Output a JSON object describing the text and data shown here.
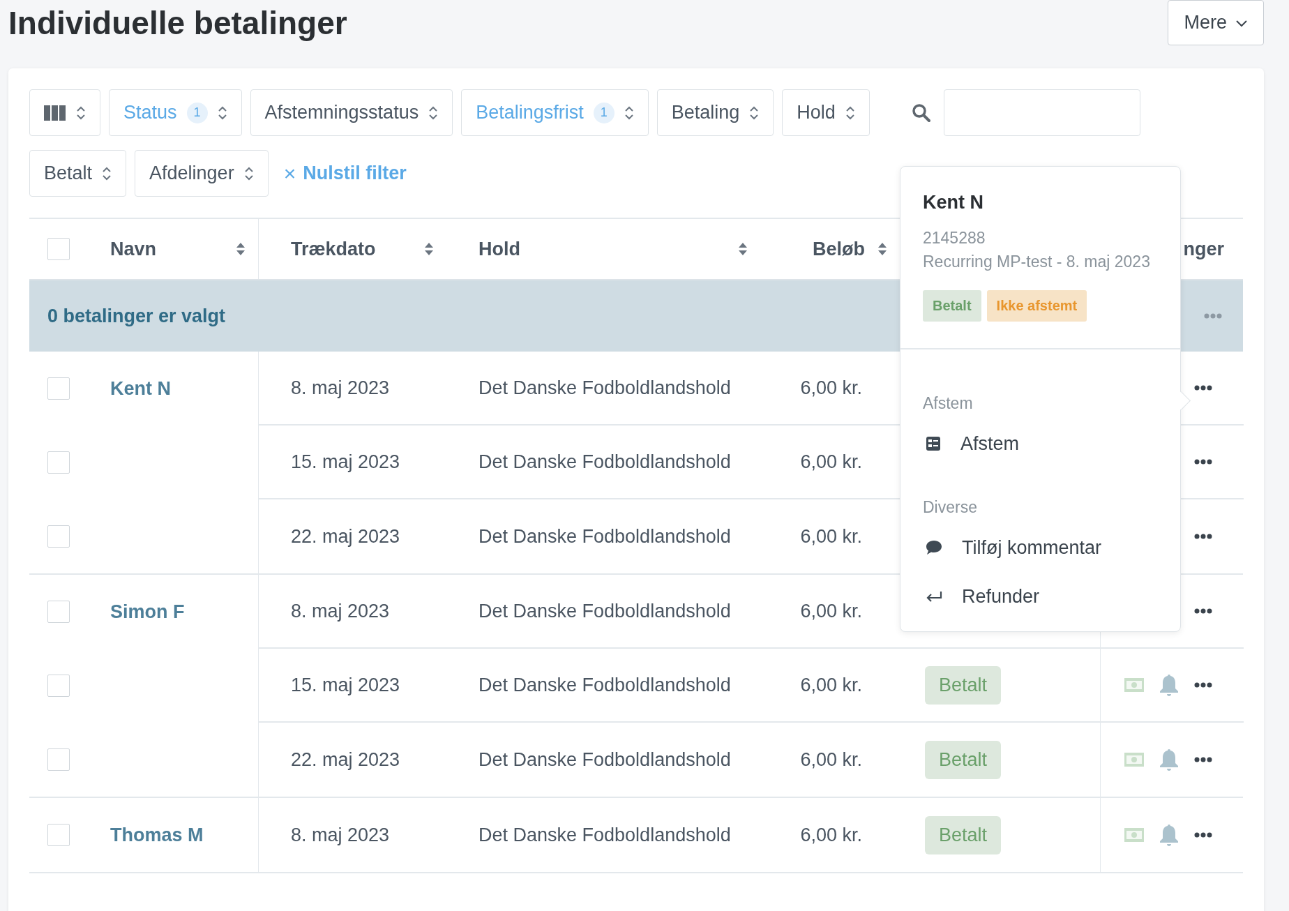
{
  "page": {
    "title": "Individuelle betalinger",
    "more_button": "Mere"
  },
  "filters": [
    {
      "kind": "columns",
      "active": false
    },
    {
      "kind": "select",
      "label": "Status",
      "count": "1",
      "active": true
    },
    {
      "kind": "select",
      "label": "Afstemningsstatus",
      "active": false
    },
    {
      "kind": "select",
      "label": "Betalingsfrist",
      "count": "1",
      "active": true
    },
    {
      "kind": "select",
      "label": "Betaling",
      "active": false
    },
    {
      "kind": "select",
      "label": "Hold",
      "active": false
    },
    {
      "kind": "search"
    },
    {
      "kind": "select",
      "label": "Betalt",
      "active": false
    },
    {
      "kind": "select",
      "label": "Afdelinger",
      "active": false
    },
    {
      "kind": "reset",
      "icon": "×",
      "label": "Nulstil filter"
    }
  ],
  "table": {
    "header_checked": false,
    "columns": [
      {
        "label": "Navn"
      },
      {
        "label": "Trækdato"
      },
      {
        "label": "Hold"
      },
      {
        "label": "Beløb"
      },
      {
        "label": "nger"
      }
    ],
    "selection_bar": "0 betalinger er valgt",
    "groups": [
      {
        "name": "Kent N",
        "payments": [
          {
            "checked": false,
            "date": "8. maj 2023",
            "team": "Det Danske Fodboldlandshold",
            "amount": "6,00 kr."
          },
          {
            "checked": false,
            "date": "15. maj 2023",
            "team": "Det Danske Fodboldlandshold",
            "amount": "6,00 kr."
          },
          {
            "checked": false,
            "date": "22. maj 2023",
            "team": "Det Danske Fodboldlandshold",
            "amount": "6,00 kr."
          }
        ]
      },
      {
        "name": "Simon F",
        "payments": [
          {
            "checked": false,
            "date": "8. maj 2023",
            "team": "Det Danske Fodboldlandshold",
            "amount": "6,00 kr."
          },
          {
            "checked": false,
            "date": "15. maj 2023",
            "team": "Det Danske Fodboldlandshold",
            "amount": "6,00 kr.",
            "status": "Betalt"
          },
          {
            "checked": false,
            "date": "22. maj 2023",
            "team": "Det Danske Fodboldlandshold",
            "amount": "6,00 kr.",
            "status": "Betalt"
          }
        ]
      },
      {
        "name": "Thomas M",
        "payments": [
          {
            "checked": false,
            "date": "8. maj 2023",
            "team": "Det Danske Fodboldlandshold",
            "amount": "6,00 kr.",
            "status": "Betalt"
          }
        ]
      }
    ]
  },
  "popup": {
    "name": "Kent N",
    "number": "2145288",
    "description": "Recurring MP-test - 8. maj 2023",
    "tags": [
      {
        "text": "Betalt",
        "kind": "paid"
      },
      {
        "text": "Ikke afstemt",
        "kind": "warning"
      }
    ],
    "sections": [
      {
        "heading": "Afstem",
        "items": [
          {
            "label": "Afstem",
            "kind": "table"
          }
        ]
      },
      {
        "heading": "Diverse",
        "items": [
          {
            "label": "Tilføj kommentar",
            "kind": "comment"
          },
          {
            "label": "Refunder",
            "kind": "return"
          }
        ]
      }
    ]
  }
}
